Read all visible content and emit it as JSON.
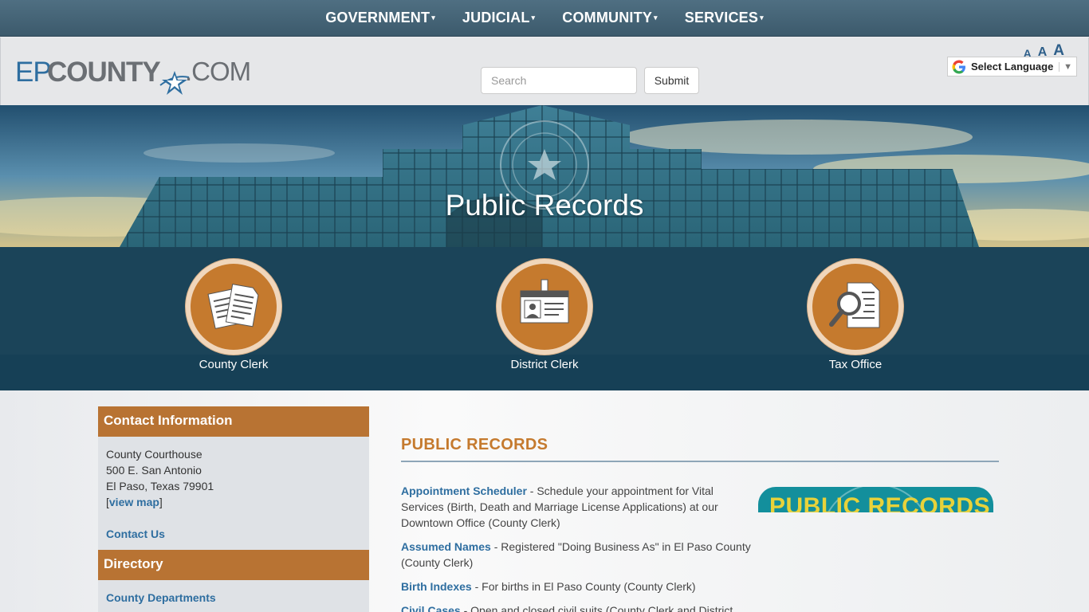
{
  "nav": {
    "items": [
      "GOVERNMENT",
      "JUDICIAL",
      "COMMUNITY",
      "SERVICES"
    ],
    "caret": "▾"
  },
  "header": {
    "logo": {
      "part1": "EP",
      "part2": "COUNTY",
      "part3": ".COM"
    },
    "search_placeholder": "Search",
    "submit_label": "Submit",
    "font_sizes": [
      "A",
      "A",
      "A"
    ],
    "translate_label": "Select Language",
    "translate_arrow": "▼"
  },
  "hero": {
    "title": "Public Records"
  },
  "icons": [
    {
      "label": "County Clerk",
      "icon": "documents-icon"
    },
    {
      "label": "District Clerk",
      "icon": "id-badge-icon"
    },
    {
      "label": "Tax Office",
      "icon": "magnify-document-icon"
    }
  ],
  "sidebar": {
    "contact_heading": "Contact Information",
    "address_lines": [
      "County Courthouse",
      "500 E. San Antonio",
      "El Paso, Texas 79901"
    ],
    "view_map_open": "[",
    "view_map": "view map",
    "view_map_close": "]",
    "contact_us": "Contact Us",
    "directory_heading": "Directory",
    "county_departments": "County Departments"
  },
  "main": {
    "title": "PUBLIC RECORDS",
    "records": [
      {
        "link": "Appointment Scheduler",
        "desc": " - Schedule your appointment for Vital Services (Birth, Death and Marriage License Applications) at our Downtown Office (County Clerk)"
      },
      {
        "link": "Assumed Names",
        "desc": " - Registered \"Doing Business As\" in El Paso County (County Clerk)"
      },
      {
        "link": "Birth Indexes",
        "desc": " - For births in El Paso County (County Clerk)"
      },
      {
        "link": "Civil Cases",
        "desc": " - Open and closed civil suits (County Clerk and District"
      }
    ],
    "badge_text": "PUBLIC RECORDS"
  },
  "colors": {
    "accent": "#c57a2e",
    "nav_bg": "#4a6a7d",
    "band_bg": "#1b4459",
    "link": "#2e6ea0"
  }
}
